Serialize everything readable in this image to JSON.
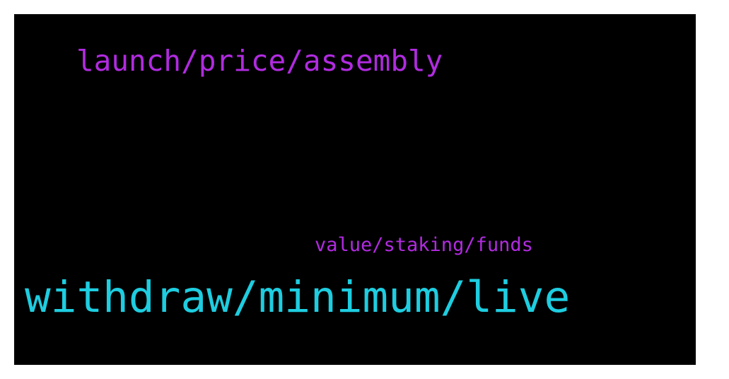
{
  "wordcloud": {
    "words": [
      {
        "text": "launch/price/assembly",
        "color": "#b12be0"
      },
      {
        "text": "value/staking/funds",
        "color": "#b12be0"
      },
      {
        "text": "withdraw/minimum/live",
        "color": "#1ecde0"
      }
    ],
    "background": "#000000"
  }
}
